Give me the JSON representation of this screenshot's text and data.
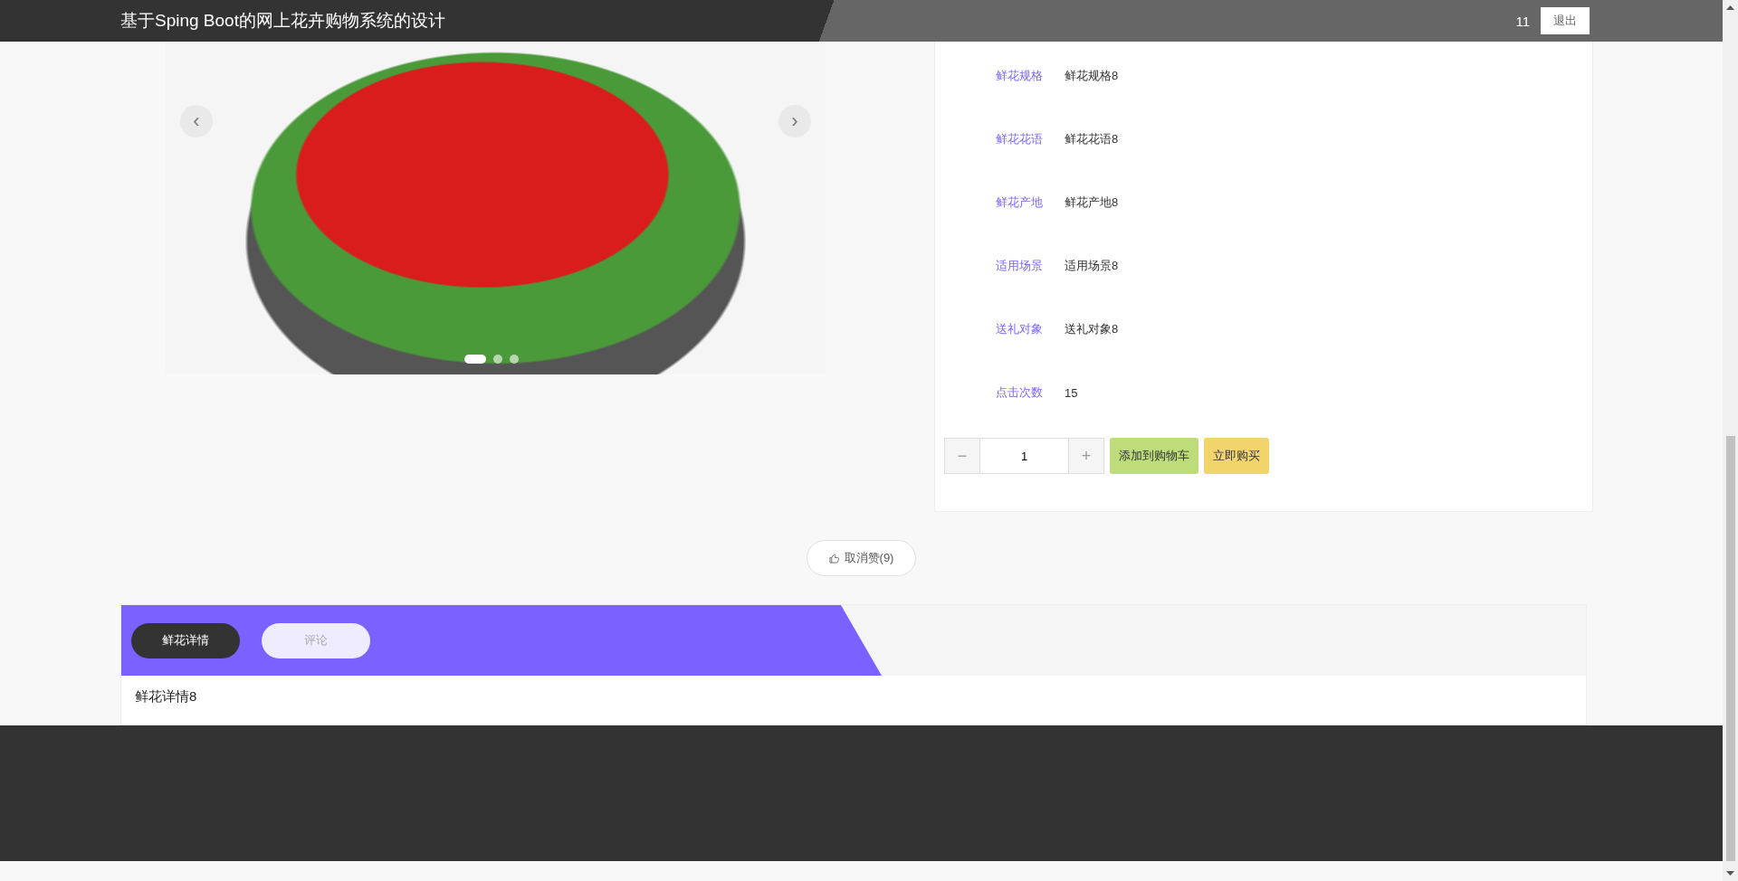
{
  "header": {
    "title": "基于Sping Boot的网上花卉购物系统的设计",
    "user": "11",
    "logout": "退出"
  },
  "carousel": {
    "prev": "‹",
    "next": "›",
    "dots": [
      {
        "selected": true
      },
      {
        "selected": false
      },
      {
        "selected": false
      }
    ]
  },
  "details": [
    {
      "label": "鲜花规格",
      "value": "鲜花规格8"
    },
    {
      "label": "鲜花花语",
      "value": "鲜花花语8"
    },
    {
      "label": "鲜花产地",
      "value": "鲜花产地8"
    },
    {
      "label": "适用场景",
      "value": "适用场景8"
    },
    {
      "label": "送礼对象",
      "value": "送礼对象8"
    },
    {
      "label": "点击次数",
      "value": "15"
    }
  ],
  "quantity": {
    "minus": "−",
    "value": "1",
    "plus": "+"
  },
  "actions": [
    {
      "kind": "cart",
      "label": "添加到购物车"
    },
    {
      "kind": "buy",
      "label": "立即购买"
    }
  ],
  "like": {
    "label": "取消赞(9)"
  },
  "tabs": [
    {
      "label": "鲜花详情",
      "selected": true
    },
    {
      "label": "评论",
      "selected": false
    }
  ],
  "tab_content": "鲜花详情8"
}
